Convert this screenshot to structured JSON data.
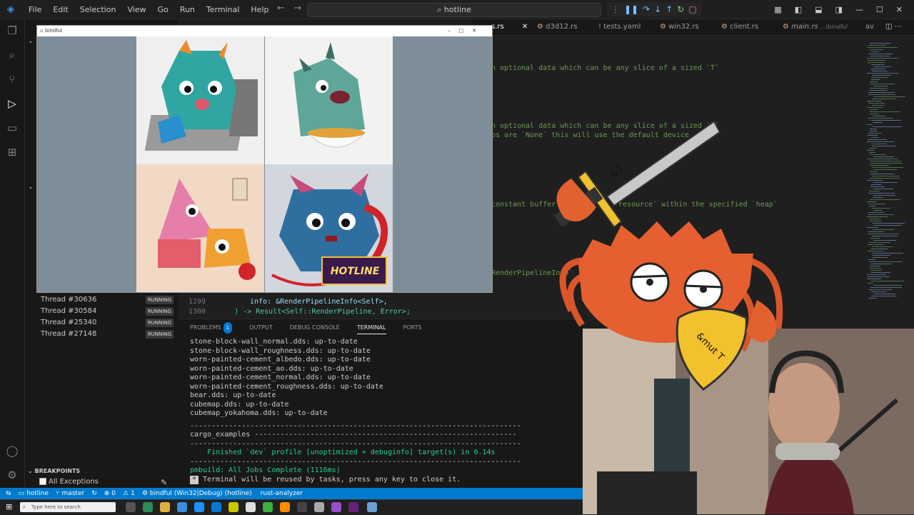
{
  "titlebar": {
    "menus": [
      "File",
      "Edit",
      "Selection",
      "View",
      "Go",
      "Run",
      "Terminal",
      "Help"
    ],
    "search": "hotline"
  },
  "tabs": [
    {
      "label": "s.rs"
    },
    {
      "label": "d3d12.rs"
    },
    {
      "label": "tests.yaml"
    },
    {
      "label": "win32.rs"
    },
    {
      "label": "client.rs"
    },
    {
      "label": "main.rs",
      "hint": "...\\bindful"
    },
    {
      "label": "av"
    }
  ],
  "editor": {
    "comments": [
      "n optional data which can be any slice of a sized `T`",
      "n optional data which can be any slice of a sized `T`",
      "ps are `None` this will use the default device",
      "constant buffer",
      "`resource` within the specified `heap`",
      "RenderPipelineInfo`"
    ],
    "lines": [
      {
        "num": "1299",
        "code": "info: &RenderPipelineInfo<Self>,"
      },
      {
        "num": "1300",
        "code": ") -> Result<Self::RenderPipeline, Error>;"
      }
    ]
  },
  "threads": [
    {
      "name": "Thread #30636",
      "state": "RUNNING"
    },
    {
      "name": "Thread #30584",
      "state": "RUNNING"
    },
    {
      "name": "Thread #25340",
      "state": "RUNNING"
    },
    {
      "name": "Thread #27148",
      "state": "RUNNING"
    }
  ],
  "breakpoints": {
    "title": "BREAKPOINTS",
    "all_exceptions": "All Exceptions"
  },
  "panel": {
    "tabs": [
      "PROBLEMS",
      "OUTPUT",
      "DEBUG CONSOLE",
      "TERMINAL",
      "PORTS"
    ],
    "problems_count": "1",
    "active_tab": "TERMINAL",
    "terminal": [
      "stone-block-wall_normal.dds: up-to-date",
      "stone-block-wall_roughness.dds: up-to-date",
      "worn-painted-cement_albedo.dds: up-to-date",
      "worn-painted-cement_ao.dds: up-to-date",
      "worn-painted-cement_normal.dds: up-to-date",
      "worn-painted-cement_roughness.dds: up-to-date",
      "bear.dds: up-to-date",
      "cubemap.dds: up-to-date",
      "cubemap_yokahoma.dds: up-to-date",
      "-----------------------------------------------------------------------------",
      "cargo_examples -------------------------------------------------------------",
      "-----------------------------------------------------------------------------",
      "    Finished `dev` profile [unoptimized + debuginfo] target(s) in 0.14s",
      "-----------------------------------------------------------------------------",
      "pmbuild: All Jobs Complete (1116ms)",
      "Terminal will be reused by tasks, press any key to close it."
    ]
  },
  "status": {
    "folder": "hotline",
    "branch": "master",
    "errors": "0",
    "warnings": "1",
    "debug": "bindful (Win32|Debug) (hotline)",
    "analyzer": "rust-analyzer"
  },
  "taskbar": {
    "search_placeholder": "Type here to search"
  },
  "appwin": {
    "title": "bindful",
    "logo_text": "HOTLINE"
  },
  "overlay": {
    "sword_label": "&T",
    "shield_label": "&mut T"
  }
}
